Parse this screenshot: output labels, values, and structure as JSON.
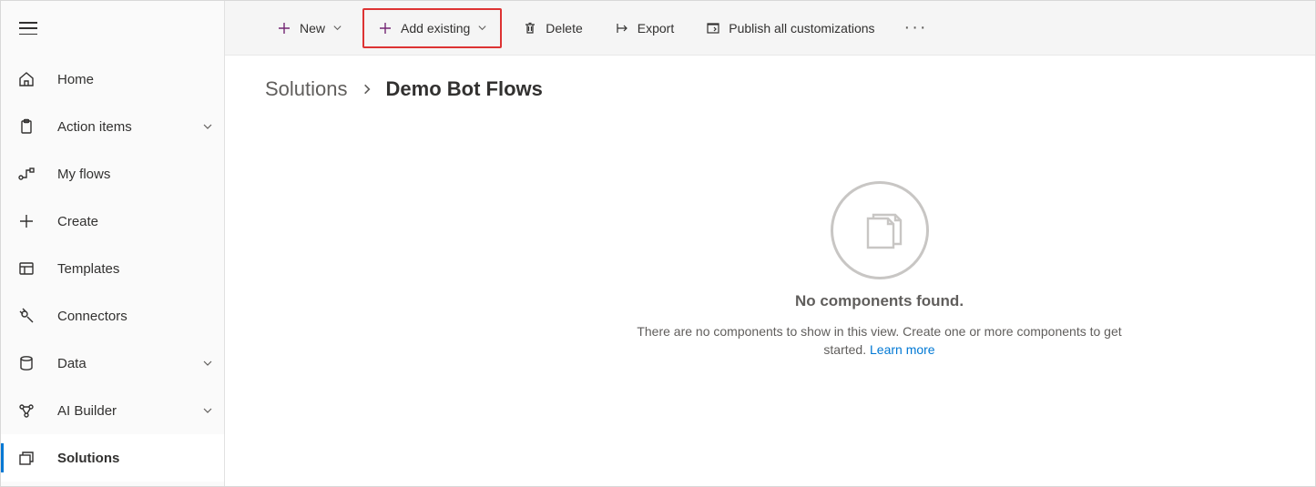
{
  "sidebar": {
    "items": [
      {
        "label": "Home",
        "icon": "home",
        "expandable": false
      },
      {
        "label": "Action items",
        "icon": "clipboard",
        "expandable": true
      },
      {
        "label": "My flows",
        "icon": "flow",
        "expandable": false
      },
      {
        "label": "Create",
        "icon": "plus",
        "expandable": false
      },
      {
        "label": "Templates",
        "icon": "templates",
        "expandable": false
      },
      {
        "label": "Connectors",
        "icon": "connectors",
        "expandable": false
      },
      {
        "label": "Data",
        "icon": "data",
        "expandable": true
      },
      {
        "label": "AI Builder",
        "icon": "ai",
        "expandable": true
      },
      {
        "label": "Solutions",
        "icon": "solutions",
        "expandable": false,
        "active": true
      }
    ]
  },
  "toolbar": {
    "new": "New",
    "add_existing": "Add existing",
    "delete": "Delete",
    "export": "Export",
    "publish": "Publish all customizations"
  },
  "breadcrumb": {
    "root": "Solutions",
    "current": "Demo Bot Flows"
  },
  "empty": {
    "title": "No components found.",
    "subtitle_1": "There are no components to show in this view. Create one or more components to get started. ",
    "learn_more": "Learn more"
  }
}
